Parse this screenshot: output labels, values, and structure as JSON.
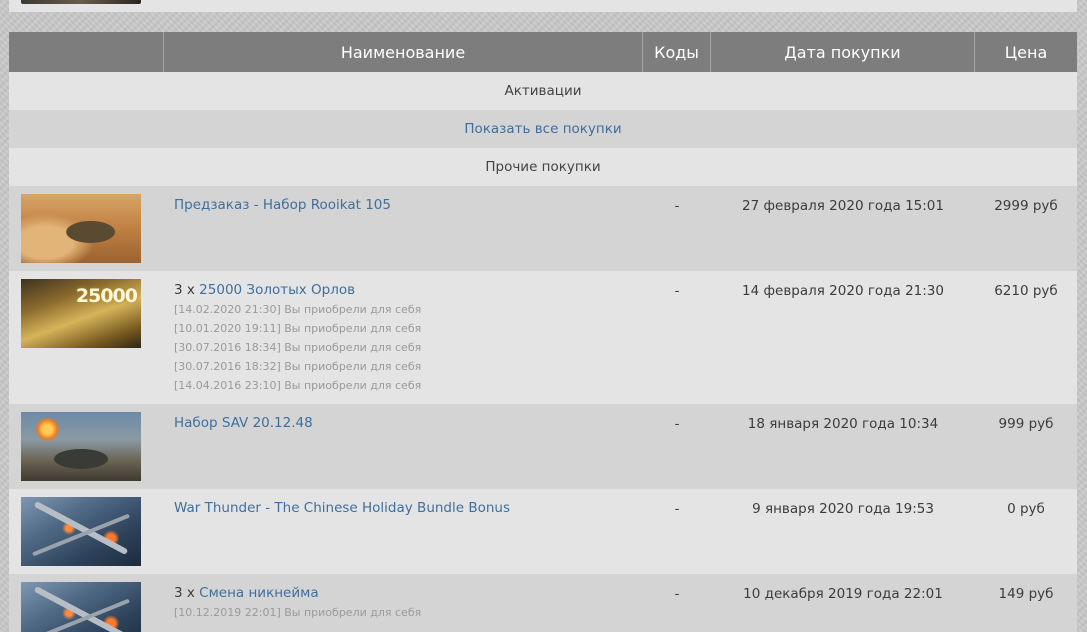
{
  "table": {
    "headers": {
      "image": "",
      "name": "Наименование",
      "codes": "Коды",
      "date": "Дата покупки",
      "price": "Цена"
    },
    "section_activations": "Активации",
    "show_all_label": "Показать все покупки",
    "section_other": "Прочие покупки",
    "rows": [
      {
        "image_icon": "tank-desert-thumbnail",
        "qty": "",
        "title": "Предзаказ - Набор Rooikat 105",
        "history": [],
        "codes": "-",
        "date": "27 февраля 2020 года 15:01",
        "price": "2999 руб"
      },
      {
        "image_icon": "gold-eagles-thumbnail",
        "image_text": "25000",
        "qty": "3 x ",
        "title": "25000 Золотых Орлов",
        "history": [
          "[14.02.2020 21:30] Вы приобрели для себя",
          "[10.01.2020 19:11] Вы приобрели для себя",
          "[30.07.2016 18:34] Вы приобрели для себя",
          "[30.07.2016 18:32] Вы приобрели для себя",
          "[14.04.2016 23:10] Вы приобрели для себя"
        ],
        "codes": "-",
        "date": "14 февраля 2020 года 21:30",
        "price": "6210 руб"
      },
      {
        "image_icon": "tank-battle-thumbnail",
        "qty": "",
        "title": "Набор SAV 20.12.48",
        "history": [],
        "codes": "-",
        "date": "18 января 2020 года 10:34",
        "price": "999 руб"
      },
      {
        "image_icon": "aircraft-thumbnail",
        "qty": "",
        "title": "War Thunder - The Chinese Holiday Bundle Bonus",
        "history": [],
        "codes": "-",
        "date": "9 января 2020 года 19:53",
        "price": "0 руб"
      },
      {
        "image_icon": "aircraft-thumbnail",
        "qty": "3 x ",
        "title": "Смена никнейма",
        "history": [
          "[10.12.2019 22:01] Вы приобрели для себя"
        ],
        "codes": "-",
        "date": "10 декабря 2019 года 22:01",
        "price": "149 руб"
      }
    ]
  },
  "colors": {
    "header_bg": "#7d7d7d",
    "row_dark": "#d4d4d4",
    "row_light": "#e4e4e4",
    "link": "#3f6f9c",
    "history_text": "#9a9a9a"
  }
}
